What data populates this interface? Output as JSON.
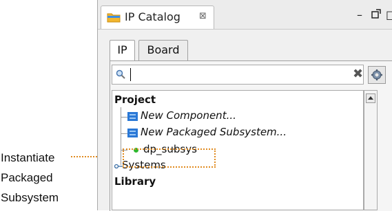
{
  "callout": {
    "lines": [
      "Instantiate",
      "Packaged",
      "Subsystem"
    ]
  },
  "view": {
    "title": "IP Catalog",
    "close_glyph": "⊠",
    "minimize_glyph": "–",
    "maximize_glyph": "□"
  },
  "tabs": [
    {
      "label": "IP",
      "active": true
    },
    {
      "label": "Board",
      "active": false
    }
  ],
  "search": {
    "value": "",
    "placeholder": ""
  },
  "tree": {
    "project": "Project",
    "items": [
      {
        "label": "New Component...",
        "icon": "component-icon"
      },
      {
        "label": "New Packaged Subsystem...",
        "icon": "component-icon"
      },
      {
        "label": "dp_subsys",
        "icon": "green-dot-icon"
      },
      {
        "label": "Systems",
        "icon": "tree-branch-icon"
      }
    ],
    "library": "Library"
  },
  "colors": {
    "highlight": "#e08a1e",
    "dot": "#2eb82e",
    "icon_blue": "#2a78d6"
  }
}
